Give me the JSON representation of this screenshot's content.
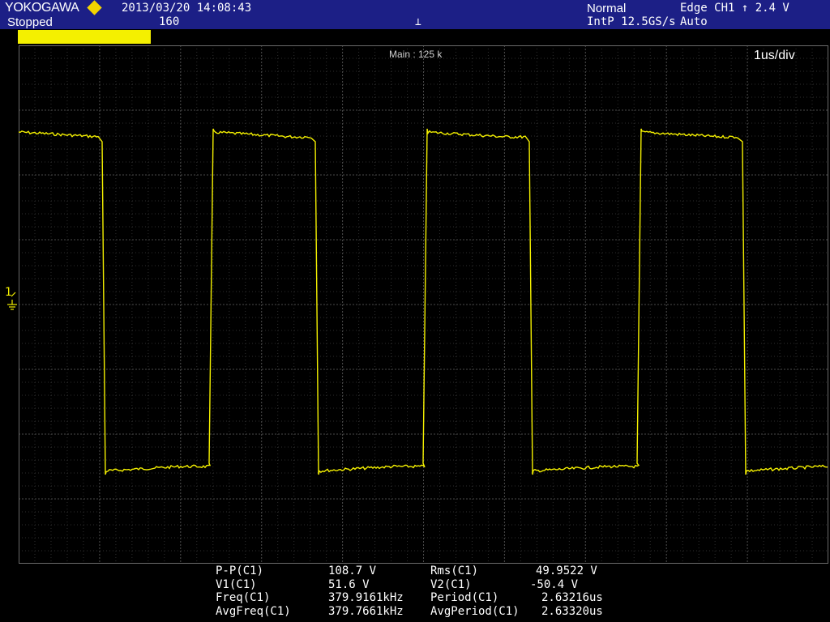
{
  "header": {
    "brand": "YOKOGAWA",
    "run_state": "Stopped",
    "datetime": "2013/03/20 14:08:43",
    "acquisition_count": "160",
    "acquisition_mode": "Normal",
    "sample_rate": "IntP 12.5GS/s",
    "trigger_source": "Edge CH1 ↑ 2.4 V",
    "trigger_mode": "Auto",
    "accent_color": "#1c1f86",
    "brand_diamond_color": "#f4d400"
  },
  "channel": {
    "number": "1",
    "scale": "20.0 V/div",
    "color": "#f4f000"
  },
  "display": {
    "zoom_label": "Main : 125 k",
    "timebase": "1us/div",
    "trace_color": "#f4f000"
  },
  "measurements": [
    {
      "label": "P-P(C1)",
      "value": "108.7 V",
      "label2": "Rms(C1)",
      "value2": "49.9522 V"
    },
    {
      "label": "V1(C1)",
      "value": "51.6 V",
      "label2": "V2(C1)",
      "value2": "-50.4 V"
    },
    {
      "label": "Freq(C1)",
      "value": "379.9161kHz",
      "label2": "Period(C1)",
      "value2": "2.63216us"
    },
    {
      "label": "AvgFreq(C1)",
      "value": "379.7661kHz",
      "label2": "AvgPeriod(C1)",
      "value2": "2.63320us"
    }
  ]
}
